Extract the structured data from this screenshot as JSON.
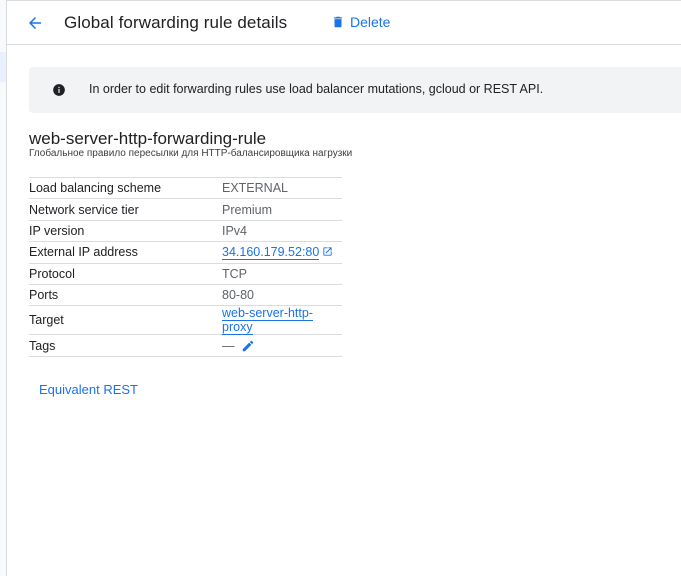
{
  "header": {
    "title": "Global forwarding rule details",
    "delete_label": "Delete"
  },
  "banner": {
    "text": "In order to edit forwarding rules use load balancer mutations, gcloud or REST API."
  },
  "rule": {
    "name": "web-server-http-forwarding-rule",
    "description": "Глобальное правило пересылки для HTTP-балансировщика нагрузки"
  },
  "details": [
    {
      "key": "Load balancing scheme",
      "value": "EXTERNAL"
    },
    {
      "key": "Network service tier",
      "value": "Premium"
    },
    {
      "key": "IP version",
      "value": "IPv4"
    },
    {
      "key": "External IP address",
      "value": "34.160.179.52:80"
    },
    {
      "key": "Protocol",
      "value": "TCP"
    },
    {
      "key": "Ports",
      "value": "80-80"
    },
    {
      "key": "Target",
      "value": "web-server-http-proxy"
    },
    {
      "key": "Tags",
      "value": "—"
    }
  ],
  "footer": {
    "equivalent_rest_label": "Equivalent REST"
  },
  "icons": {
    "back": "arrow-back-icon",
    "delete": "trash-icon",
    "info": "info-icon",
    "external_link": "open-in-new-icon",
    "edit": "pencil-icon"
  },
  "colors": {
    "accent": "#1a73e8",
    "banner_bg": "#f1f3f4",
    "text": "#202124",
    "muted": "#5f6368",
    "divider": "#dadce0"
  }
}
